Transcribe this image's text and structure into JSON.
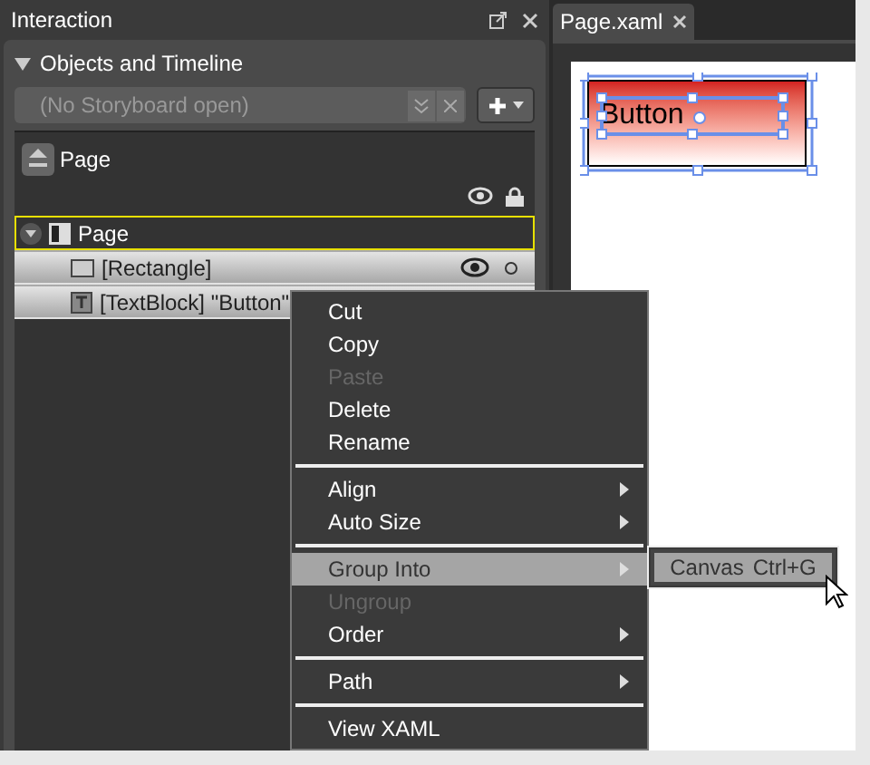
{
  "panel": {
    "title": "Interaction",
    "section": {
      "title": "Objects and Timeline",
      "expanded": true
    },
    "storyboard": {
      "placeholder": "(No Storyboard open)"
    },
    "scope": {
      "label": "Page"
    },
    "tree": [
      {
        "label": "Page",
        "kind": "container",
        "active": true,
        "expanded": true,
        "selected": false,
        "children": [
          {
            "label": "[Rectangle]",
            "kind": "rectangle",
            "active": false,
            "selected": true
          },
          {
            "label": "[TextBlock] \"Button\"",
            "kind": "textblock",
            "active": false,
            "selected": true
          }
        ]
      }
    ]
  },
  "document_tabs": [
    {
      "label": "Page.xaml",
      "selected": true
    }
  ],
  "artboard": {
    "button_text": "Button"
  },
  "context_menu": {
    "items": [
      {
        "kind": "item",
        "label": "Cut",
        "disabled": false,
        "submenu": false,
        "selected": false
      },
      {
        "kind": "item",
        "label": "Copy",
        "disabled": false,
        "submenu": false,
        "selected": false
      },
      {
        "kind": "item",
        "label": "Paste",
        "disabled": true,
        "submenu": false,
        "selected": false
      },
      {
        "kind": "item",
        "label": "Delete",
        "disabled": false,
        "submenu": false,
        "selected": false
      },
      {
        "kind": "item",
        "label": "Rename",
        "disabled": false,
        "submenu": false,
        "selected": false
      },
      {
        "kind": "separator"
      },
      {
        "kind": "item",
        "label": "Align",
        "disabled": false,
        "submenu": true,
        "selected": false
      },
      {
        "kind": "item",
        "label": "Auto Size",
        "disabled": false,
        "submenu": true,
        "selected": false
      },
      {
        "kind": "separator"
      },
      {
        "kind": "item",
        "label": "Group Into",
        "disabled": false,
        "submenu": true,
        "selected": true
      },
      {
        "kind": "item",
        "label": "Ungroup",
        "disabled": true,
        "submenu": false,
        "selected": false
      },
      {
        "kind": "item",
        "label": "Order",
        "disabled": false,
        "submenu": true,
        "selected": false
      },
      {
        "kind": "separator"
      },
      {
        "kind": "item",
        "label": "Path",
        "disabled": false,
        "submenu": true,
        "selected": false
      },
      {
        "kind": "separator"
      },
      {
        "kind": "item",
        "label": "View XAML",
        "disabled": false,
        "submenu": false,
        "selected": false
      }
    ]
  },
  "submenu": {
    "items": [
      {
        "label": "Canvas",
        "shortcut": "Ctrl+G",
        "selected": true
      }
    ]
  }
}
